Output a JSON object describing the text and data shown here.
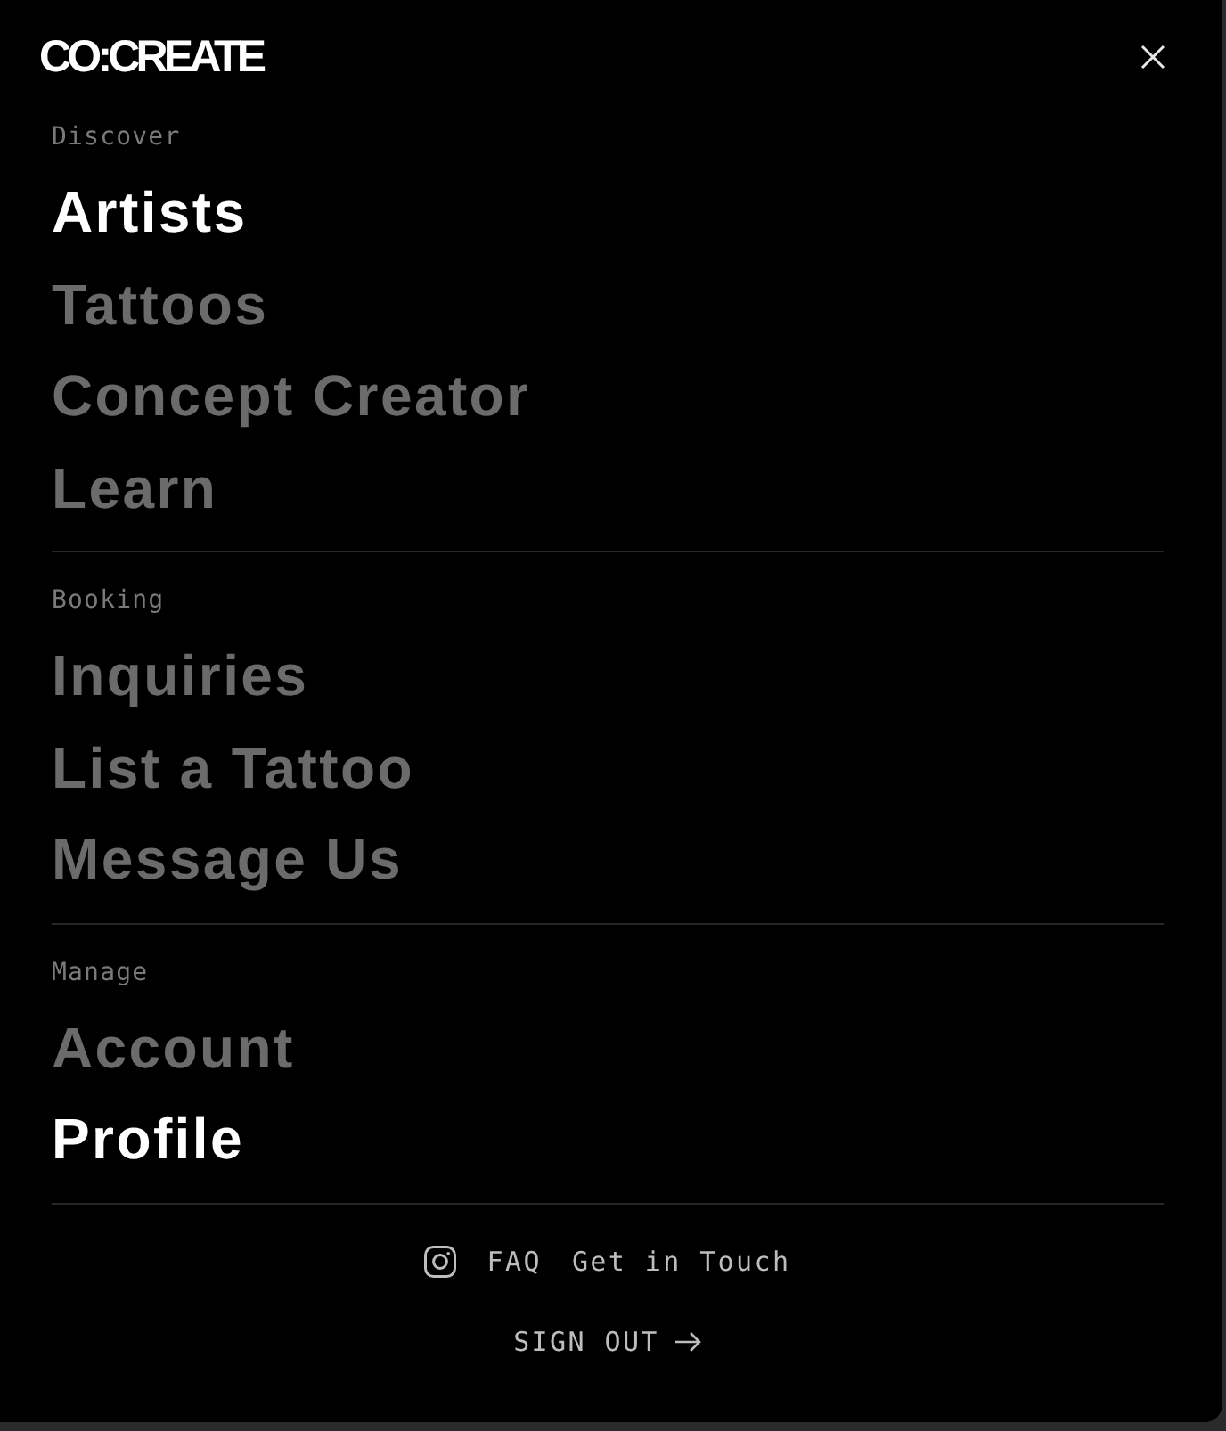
{
  "header": {
    "logo": "CO:CREATE"
  },
  "sections": [
    {
      "label": "Discover",
      "items": [
        {
          "label": "Artists",
          "selected": true
        },
        {
          "label": "Tattoos",
          "selected": false
        },
        {
          "label": "Concept Creator",
          "selected": false
        },
        {
          "label": "Learn",
          "selected": false
        }
      ]
    },
    {
      "label": "Booking",
      "items": [
        {
          "label": "Inquiries",
          "selected": false
        },
        {
          "label": "List a Tattoo",
          "selected": false
        },
        {
          "label": "Message Us",
          "selected": false
        }
      ]
    },
    {
      "label": "Manage",
      "items": [
        {
          "label": "Account",
          "selected": false
        },
        {
          "label": "Profile",
          "selected": true
        }
      ]
    }
  ],
  "footer": {
    "links": [
      "FAQ",
      "Get in Touch"
    ],
    "sign_out": "SIGN OUT"
  }
}
